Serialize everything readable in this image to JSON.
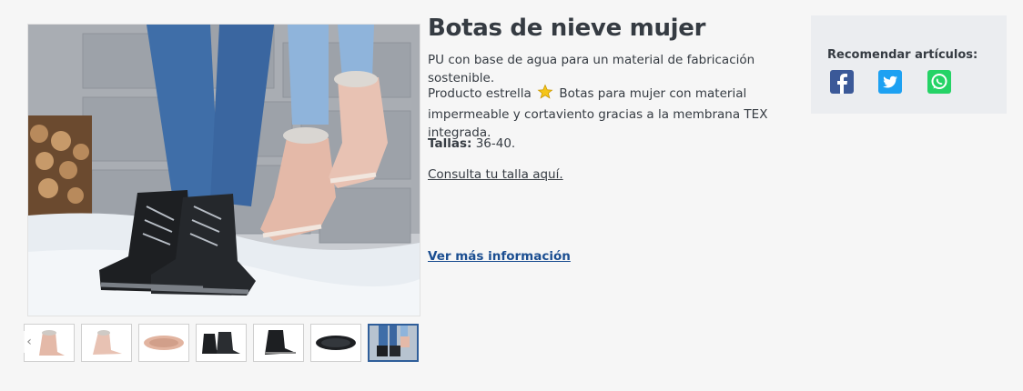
{
  "product": {
    "title": "Botas de nieve mujer",
    "line1": "PU con base de agua para un material de fabricación sostenible.",
    "line2_prefix": "Producto estrella",
    "line2_rest": "Botas para mujer con material impermeable y cortaviento gracias a la membrana TEX integrada.",
    "sizes_label": "Tallas:",
    "sizes_value": "36-40.",
    "size_guide_link": "Consulta tu talla aquí.",
    "more_info_link": "Ver más información"
  },
  "share": {
    "title": "Recomendar artículos:",
    "icons": [
      "facebook-icon",
      "twitter-icon",
      "whatsapp-icon"
    ]
  },
  "gallery": {
    "prev_arrow": "‹",
    "thumb_count": 7,
    "active_index": 6
  },
  "colors": {
    "text": "#353b42",
    "link_blue": "#1b4e91",
    "share_bg": "#ebedf0",
    "facebook": "#3b5998",
    "twitter": "#1da1f2",
    "whatsapp": "#25d366"
  }
}
